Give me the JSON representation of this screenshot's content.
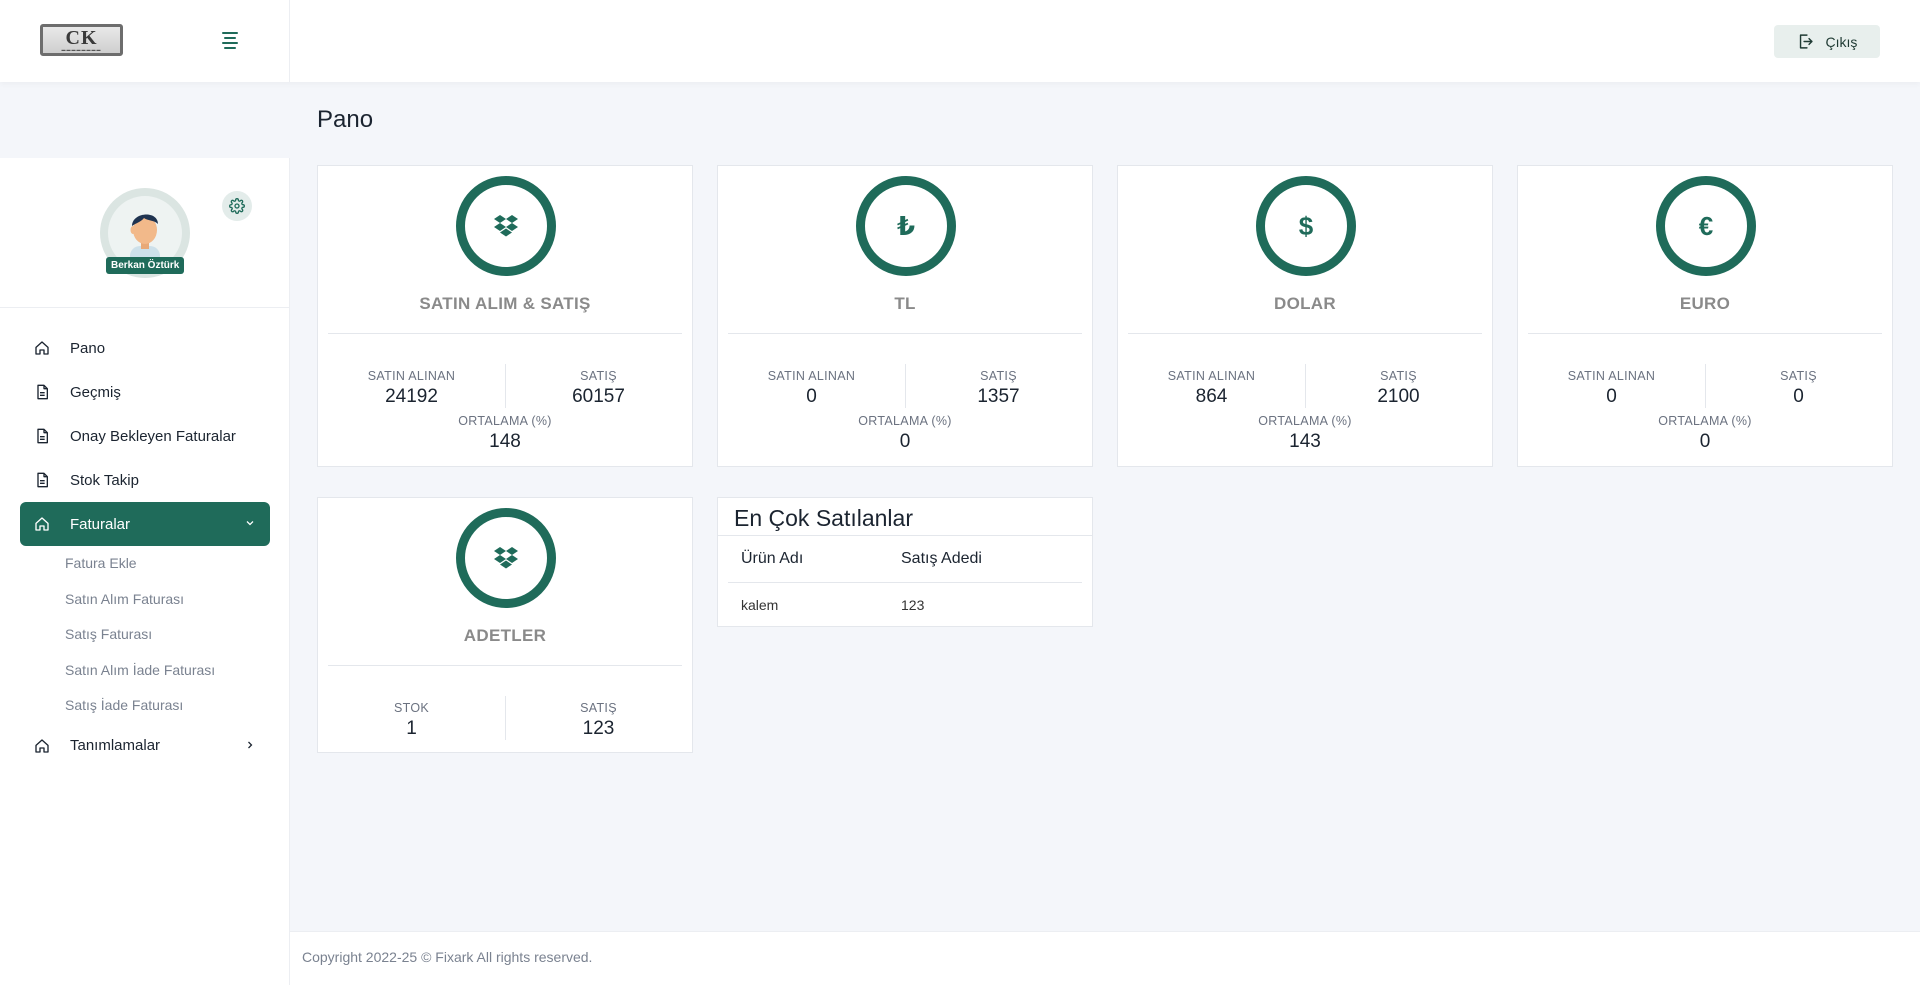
{
  "header": {
    "logo_text": "CK",
    "logout_label": "Çıkış"
  },
  "sidebar": {
    "user_name": "Berkan Öztürk",
    "items": [
      {
        "label": "Pano",
        "icon": "home-icon"
      },
      {
        "label": "Geçmiş",
        "icon": "document-icon"
      },
      {
        "label": "Onay Bekleyen Faturalar",
        "icon": "document-icon"
      },
      {
        "label": "Stok Takip",
        "icon": "document-icon"
      },
      {
        "label": "Faturalar",
        "icon": "home-icon",
        "active": true
      },
      {
        "label": "Tanımlamalar",
        "icon": "home-icon"
      }
    ],
    "subitems": [
      {
        "label": "Fatura Ekle"
      },
      {
        "label": "Satın Alım Faturası"
      },
      {
        "label": "Satış Faturası"
      },
      {
        "label": "Satın Alım İade Faturası"
      },
      {
        "label": "Satış İade Faturası"
      }
    ]
  },
  "main": {
    "title": "Pano",
    "cards": [
      {
        "title": "SATIN ALIM & SATIŞ",
        "icon": "dropbox-icon",
        "left_label": "SATIN ALINAN",
        "left_value": "24192",
        "right_label": "SATIŞ",
        "right_value": "60157",
        "avg_label": "ORTALAMA (%)",
        "avg_value": "148"
      },
      {
        "title": "TL",
        "icon": "lira-icon",
        "symbol": "₺",
        "left_label": "SATIN ALINAN",
        "left_value": "0",
        "right_label": "SATIŞ",
        "right_value": "1357",
        "avg_label": "ORTALAMA (%)",
        "avg_value": "0"
      },
      {
        "title": "DOLAR",
        "icon": "dollar-icon",
        "symbol": "$",
        "left_label": "SATIN ALINAN",
        "left_value": "864",
        "right_label": "SATIŞ",
        "right_value": "2100",
        "avg_label": "ORTALAMA (%)",
        "avg_value": "143"
      },
      {
        "title": "EURO",
        "icon": "euro-icon",
        "symbol": "€",
        "left_label": "SATIN ALINAN",
        "left_value": "0",
        "right_label": "SATIŞ",
        "right_value": "0",
        "avg_label": "ORTALAMA (%)",
        "avg_value": "0"
      }
    ],
    "quantity_card": {
      "title": "ADETLER",
      "icon": "dropbox-icon",
      "left_label": "STOK",
      "left_value": "1",
      "right_label": "SATIŞ",
      "right_value": "123"
    },
    "top_sellers": {
      "title": "En Çok Satılanlar",
      "columns": [
        "Ürün Adı",
        "Satış Adedi"
      ],
      "rows": [
        [
          "kalem",
          "123"
        ]
      ]
    }
  },
  "footer": {
    "copyright": "Copyright 2022-25 © Fixark All rights reserved."
  },
  "colors": {
    "accent": "#1f6b5a",
    "background": "#f4f6fa"
  }
}
